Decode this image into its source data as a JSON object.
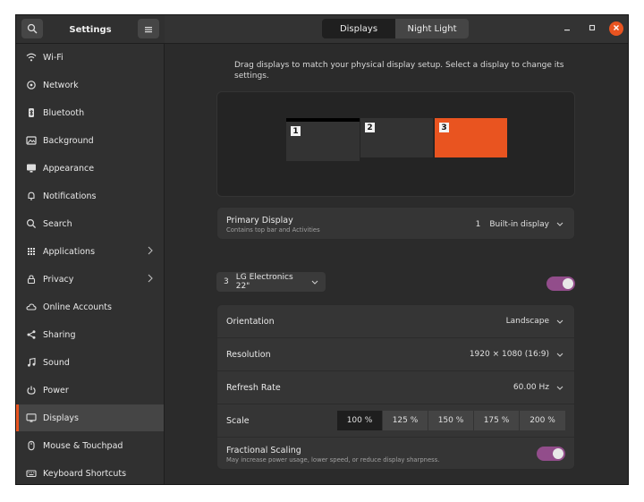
{
  "window": {
    "title": "Settings"
  },
  "header": {
    "tabs": [
      {
        "label": "Displays",
        "active": true
      },
      {
        "label": "Night Light",
        "active": false
      }
    ]
  },
  "sidebar": {
    "items": [
      {
        "label": "Wi-Fi",
        "icon": "wifi-icon"
      },
      {
        "label": "Network",
        "icon": "network-icon"
      },
      {
        "label": "Bluetooth",
        "icon": "bluetooth-icon"
      },
      {
        "label": "Background",
        "icon": "background-icon"
      },
      {
        "label": "Appearance",
        "icon": "appearance-icon"
      },
      {
        "label": "Notifications",
        "icon": "bell-icon"
      },
      {
        "label": "Search",
        "icon": "search-icon"
      },
      {
        "label": "Applications",
        "icon": "grid-icon",
        "submenu": true
      },
      {
        "label": "Privacy",
        "icon": "lock-icon",
        "submenu": true
      },
      {
        "label": "Online Accounts",
        "icon": "cloud-icon"
      },
      {
        "label": "Sharing",
        "icon": "share-icon"
      },
      {
        "label": "Sound",
        "icon": "music-note-icon"
      },
      {
        "label": "Power",
        "icon": "power-icon"
      },
      {
        "label": "Displays",
        "icon": "display-icon",
        "active": true
      },
      {
        "label": "Mouse & Touchpad",
        "icon": "mouse-icon"
      },
      {
        "label": "Keyboard Shortcuts",
        "icon": "keyboard-icon"
      }
    ]
  },
  "main": {
    "intro": "Drag displays to match your physical display setup. Select a display to change its settings.",
    "monitors": [
      {
        "number": "1",
        "selected": false
      },
      {
        "number": "2",
        "selected": false
      },
      {
        "number": "3",
        "selected": true
      }
    ],
    "primary": {
      "label": "Primary Display",
      "sub": "Contains top bar and Activities",
      "number": "1",
      "value": "Built-in display"
    },
    "selected_monitor": {
      "number": "3",
      "name": "LG Electronics 22\"",
      "enabled": true
    },
    "settings": {
      "orientation": {
        "label": "Orientation",
        "value": "Landscape"
      },
      "resolution": {
        "label": "Resolution",
        "value": "1920 × 1080 (16:9)"
      },
      "refresh": {
        "label": "Refresh Rate",
        "value": "60.00 Hz"
      },
      "scale": {
        "label": "Scale",
        "options": [
          "100 %",
          "125 %",
          "150 %",
          "175 %",
          "200 %"
        ],
        "selected": "100 %"
      },
      "fractional": {
        "label": "Fractional Scaling",
        "sub": "May increase power usage, lower speed, or reduce display sharpness.",
        "enabled": true
      }
    }
  },
  "colors": {
    "accent": "#e95420",
    "toggle_on": "#924d8b",
    "bg": "#2b2b2b",
    "sidebar_bg": "#303030"
  }
}
